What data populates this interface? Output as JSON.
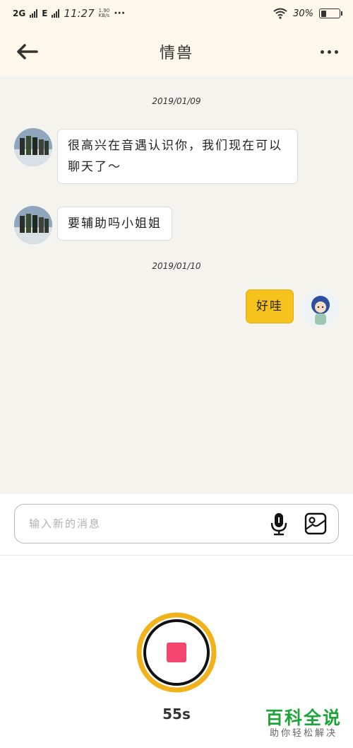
{
  "status_bar": {
    "network_1": "2G",
    "network_2": "E",
    "time": "11:27",
    "speed_value": "1.90",
    "speed_unit": "KB/s",
    "more": "···",
    "battery": "30%"
  },
  "header": {
    "title": "情兽"
  },
  "messages": [
    {
      "type": "date",
      "text": "2019/01/09"
    },
    {
      "type": "received",
      "text": "很高兴在音遇认识你，我们现在可以聊天了～"
    },
    {
      "type": "received",
      "text": "要辅助吗小姐姐"
    },
    {
      "type": "date",
      "text": "2019/01/10"
    },
    {
      "type": "sent",
      "text": "好哇"
    }
  ],
  "input": {
    "placeholder": "输入新的消息"
  },
  "recorder": {
    "elapsed": "55s",
    "accent_color": "#f2b21c",
    "stop_color": "#f2466f"
  },
  "watermark": {
    "main": "百科全说",
    "sub": "助你轻松解决"
  }
}
